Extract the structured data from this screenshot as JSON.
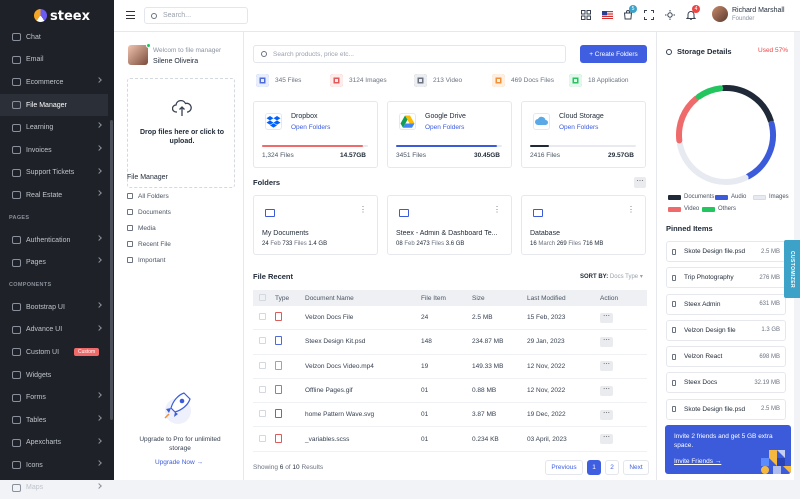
{
  "app": {
    "logo": "steex"
  },
  "sidebar": {
    "items": [
      {
        "label": "Chat",
        "chevron": false
      },
      {
        "label": "Email",
        "chevron": false
      },
      {
        "label": "Ecommerce",
        "chevron": true
      },
      {
        "label": "File Manager",
        "chevron": false,
        "active": true
      },
      {
        "label": "Learning",
        "chevron": true
      },
      {
        "label": "Invoices",
        "chevron": true
      },
      {
        "label": "Support Tickets",
        "chevron": true
      },
      {
        "label": "Real Estate",
        "chevron": true
      }
    ],
    "pages_head": "PAGES",
    "pages": [
      {
        "label": "Authentication",
        "chevron": true
      },
      {
        "label": "Pages",
        "chevron": true
      }
    ],
    "components_head": "COMPONENTS",
    "components": [
      {
        "label": "Bootstrap UI",
        "chevron": true
      },
      {
        "label": "Advance UI",
        "chevron": true
      },
      {
        "label": "Custom UI",
        "chevron": false,
        "badge": "Custom"
      },
      {
        "label": "Widgets",
        "chevron": false
      },
      {
        "label": "Forms",
        "chevron": true
      },
      {
        "label": "Tables",
        "chevron": true
      },
      {
        "label": "Apexcharts",
        "chevron": true
      },
      {
        "label": "Icons",
        "chevron": true
      },
      {
        "label": "Maps",
        "chevron": true
      }
    ]
  },
  "topbar": {
    "search_placeholder": "Search...",
    "cart_count": "5",
    "notif_count": "4",
    "user_name": "Richard Marshall",
    "user_role": "Founder"
  },
  "left": {
    "welcome": "Welcom to file manager",
    "name": "Silene Oliveira",
    "drop_text": "Drop files here or click to upload.",
    "fm_title": "File Manager",
    "fm_items": [
      "All Folders",
      "Documents",
      "Media",
      "Recent File",
      "Important"
    ],
    "upgrade_text": "Upgrade to Pro for unlimited storage",
    "upgrade_link": "Upgrade Now →"
  },
  "main": {
    "search_placeholder": "Search products, price etc...",
    "create_label": "+ Create Folders",
    "filetypes": [
      {
        "label": "345 Files",
        "color": "#e8eefc",
        "ico": "#4f6bdb"
      },
      {
        "label": "3124 Images",
        "color": "#fdecec",
        "ico": "#e05a5a"
      },
      {
        "label": "213 Video",
        "color": "#eceef1",
        "ico": "#6b7280"
      },
      {
        "label": "469 Docs Files",
        "color": "#fdf0e3",
        "ico": "#f0913a"
      },
      {
        "label": "18 Application",
        "color": "#e5f6ec",
        "ico": "#22c55e"
      }
    ],
    "clouds": [
      {
        "name": "Dropbox",
        "open": "Open Folders",
        "files": "1,324 Files",
        "size": "14.57GB",
        "fill": 0.95,
        "color": "#ef6a6a"
      },
      {
        "name": "Google Drive",
        "open": "Open Folders",
        "files": "3451 Files",
        "size": "30.45GB",
        "fill": 0.95,
        "color": "#3b5bdb"
      },
      {
        "name": "Cloud Storage",
        "open": "Open Folders",
        "files": "2416 Files",
        "size": "29.57GB",
        "fill": 0.18,
        "color": "#1f2937"
      }
    ],
    "folders_title": "Folders",
    "folders": [
      {
        "name": "My Documents",
        "date": "24",
        "month": "Feb",
        "files": "733",
        "files_label": "Files",
        "size": "1.4 GB"
      },
      {
        "name": "Steex - Admin & Dashboard Te...",
        "date": "08",
        "month": "Feb",
        "files": "2473",
        "files_label": "Files",
        "size": "3.6 GB"
      },
      {
        "name": "Database",
        "date": "16",
        "month": "March",
        "files": "269",
        "files_label": "Files",
        "size": "716 MB"
      }
    ],
    "recent_title": "File Recent",
    "sort_label": "SORT BY:",
    "sort_value": "Docs Type",
    "columns": [
      "Type",
      "Document Name",
      "File Item",
      "Size",
      "Last Modified",
      "Action"
    ],
    "rows": [
      {
        "name": "Velzon Docs File",
        "items": "24",
        "size": "2.5 MB",
        "modified": "15 Feb, 2023",
        "color": "#e05a5a"
      },
      {
        "name": "Steex Design Kit.psd",
        "items": "148",
        "size": "234.87 MB",
        "modified": "29 Jan, 2023",
        "color": "#4f6bdb"
      },
      {
        "name": "Velzon Docs Video.mp4",
        "items": "19",
        "size": "149.33 MB",
        "modified": "12 Nov, 2022",
        "color": "#f0913a"
      },
      {
        "name": "Offline Pages.gif",
        "items": "01",
        "size": "0.88 MB",
        "modified": "12 Nov, 2022",
        "color": "#22c55e"
      },
      {
        "name": "home Pattern Wave.svg",
        "items": "01",
        "size": "3.87 MB",
        "modified": "19 Dec, 2022",
        "color": "#6b7280"
      },
      {
        "name": "_variables.scss",
        "items": "01",
        "size": "0.234 KB",
        "modified": "03 April, 2023",
        "color": "#e05a5a"
      }
    ],
    "showing_prefix": "Showing",
    "showing_count": "6",
    "showing_of": "of",
    "showing_total": "10",
    "showing_suffix": "Results",
    "pager": {
      "prev": "Previous",
      "p1": "1",
      "p2": "2",
      "next": "Next"
    }
  },
  "right": {
    "storage_title": "Storage Details",
    "used": "Used 57%",
    "donut": [
      {
        "label": "Documents",
        "value": 22,
        "color": "#1f2937"
      },
      {
        "label": "Audio",
        "value": 22,
        "color": "#3b5bdb"
      },
      {
        "label": "Images",
        "value": 30,
        "color": "#e8eaf2"
      },
      {
        "label": "Video",
        "value": 17,
        "color": "#ef6a6a"
      },
      {
        "label": "Others",
        "value": 9,
        "color": "#22c55e"
      }
    ],
    "pinned_title": "Pinned Items",
    "pinned": [
      {
        "name": "Skote Design file.psd",
        "size": "2.5 MB"
      },
      {
        "name": "Trip Photography",
        "size": "276 MB"
      },
      {
        "name": "Steex Admin",
        "size": "631 MB"
      },
      {
        "name": "Velzon Design file",
        "size": "1.3 GB"
      },
      {
        "name": "Velzon React",
        "size": "698 MB"
      },
      {
        "name": "Steex Docs",
        "size": "32.19 MB"
      },
      {
        "name": "Skote Design file.psd",
        "size": "2.5 MB"
      }
    ],
    "invite_text": "Invite 2 friends and get 5 GB extra space.",
    "invite_link": "Invite Friends →"
  },
  "customizer": "CUSTOMIZER"
}
